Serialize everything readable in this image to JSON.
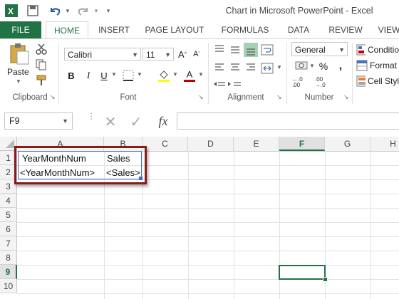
{
  "window": {
    "title": "Chart in Microsoft PowerPoint - Excel"
  },
  "tabs": [
    "FILE",
    "HOME",
    "INSERT",
    "PAGE LAYOUT",
    "FORMULAS",
    "DATA",
    "REVIEW",
    "VIEW"
  ],
  "ribbon": {
    "clipboard": {
      "paste_label": "Paste",
      "group_label": "Clipboard"
    },
    "font": {
      "font_name": "Calibri",
      "font_size": "11",
      "group_label": "Font"
    },
    "alignment": {
      "group_label": "Alignment"
    },
    "number": {
      "format": "General",
      "group_label": "Number"
    },
    "styles": {
      "conditional": "Conditio",
      "format": "Format",
      "cell_styles": "Cell Styl"
    }
  },
  "formula_bar": {
    "name_box": "F9",
    "fx": "fx",
    "value": ""
  },
  "columns": [
    "A",
    "B",
    "C",
    "D",
    "E",
    "F",
    "G",
    "H"
  ],
  "rows": [
    "1",
    "2",
    "3",
    "4",
    "5",
    "6",
    "7",
    "8",
    "9",
    "10"
  ],
  "cells": {
    "a1": "YearMonthNum",
    "b1": "Sales",
    "a2": "<YearMonthNum>",
    "b2": "<Sales>"
  },
  "selected_cell": "F9",
  "colors": {
    "excel_green": "#217346",
    "highlight_border": "#8b1a1a"
  }
}
